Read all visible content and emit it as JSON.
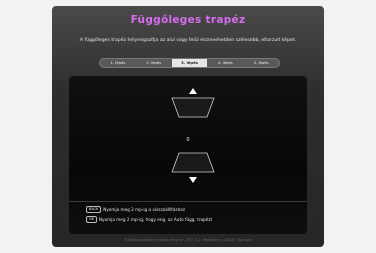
{
  "title": "Függőleges trapéz",
  "description": "A függőleges trapéz helyreigazítja az alul vagy felül észrevehetően szélesebb, eltorzult képet.",
  "steps": [
    {
      "label": "1. lépés",
      "active": false
    },
    {
      "label": "2. lépés",
      "active": false
    },
    {
      "label": "3. lépés",
      "active": true
    },
    {
      "label": "4. lépés",
      "active": false
    },
    {
      "label": "5. lépés",
      "active": false
    }
  ],
  "keystone_value": "0",
  "hints": [
    {
      "key": "BACK",
      "text": "Nyomja meg 2 mp-ig a visszaállításhoz"
    },
    {
      "key": "OK",
      "text": "Nyomja meg 2 mp-ig, hogy eng. az Auto függ. trapézt"
    }
  ],
  "footer": "A kiválasztáshoz nyomja meg az „OK”, a 2. lépéshez a „BACK” gombot"
}
